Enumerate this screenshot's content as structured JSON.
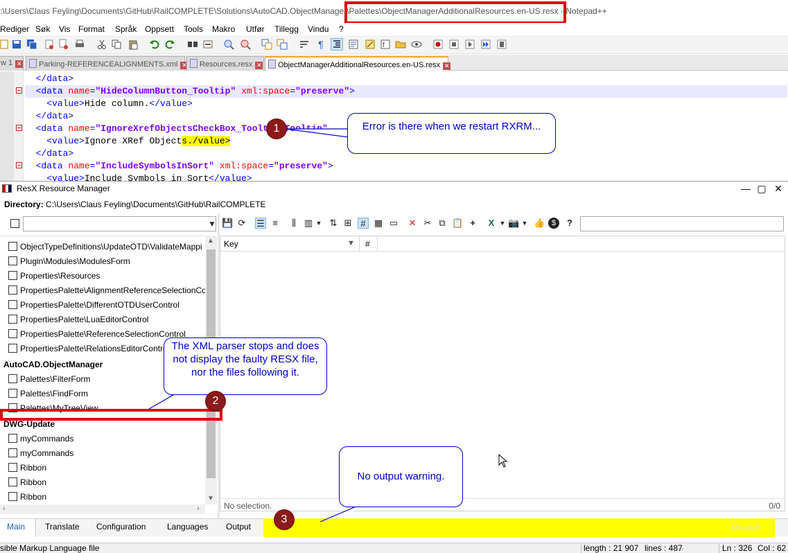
{
  "notepad": {
    "title_prefix": ":\\Users\\Claus Feyling\\Documents\\GitHub\\RailCOMPLETE\\Solutions\\AutoCAD.ObjectManager\\",
    "title_highlight": "Palettes\\ObjectManagerAdditionalResources.en-US.resx - ",
    "title_suffix": "Notepad++",
    "menu": [
      "Rediger",
      "Søk",
      "Vis",
      "Format",
      "Språk",
      "Oppsett",
      "Tools",
      "Makro",
      "Utfør",
      "Tillegg",
      "Vindu",
      "?"
    ],
    "tabs": [
      {
        "label": "w 1"
      },
      {
        "label": "Parking-REFERENCEALIGNMENTS.xml"
      },
      {
        "label": "Resources.resx"
      },
      {
        "label": "ObjectManagerAdditionalResources.en-US.resx"
      }
    ],
    "code": [
      {
        "indent": "  ",
        "close": "</data>"
      },
      {
        "indent": "  ",
        "open": "<data ",
        "attr1": "name",
        "eq1": "=",
        "val1": "\"HideColumnButton_Tooltip\"",
        "attr2": " xml:space",
        "eq2": "=",
        "val2": "\"preserve\"",
        "end": ">"
      },
      {
        "indent": "    ",
        "open": "<value>",
        "text": "Hide column.",
        "end": "</value>"
      },
      {
        "indent": "  ",
        "close": "</data>"
      },
      {
        "indent": "  ",
        "open": "<data ",
        "attr1": "name",
        "eq1": "=",
        "val1": "\"IgnoreXrefObjectsCheckBox_Tooltip_Tooltip\"",
        "end": ""
      },
      {
        "indent": "    ",
        "open": "<value>",
        "text": "Ignore XRef Object",
        "hl": "s./value>"
      },
      {
        "indent": "  ",
        "close": "</data>"
      },
      {
        "indent": "  ",
        "open": "<data ",
        "attr1": "name",
        "eq1": "=",
        "val1": "\"IncludeSymbolsInSort\"",
        "attr2": " xml:space",
        "eq2": "=",
        "val2": "\"preserve\"",
        "end": ">"
      },
      {
        "indent": "    ",
        "open": "<value>",
        "text": "Include Symbols in Sort",
        "end": "</value>"
      }
    ],
    "status": {
      "filetype": "sible Markup Language file",
      "length": "length : 21 907",
      "lines": "lines : 487",
      "ln": "Ln : 326",
      "col": "Col : 62"
    }
  },
  "resx": {
    "title": "ResX Resource Manager",
    "directory_label": "Directory:",
    "directory_value": "C:\\Users\\Claus Feyling\\Documents\\GitHub\\RailCOMPLETE",
    "list": [
      {
        "type": "item",
        "label": "ObjectTypeDefinitions\\UpdateOTD\\ValidateMappi"
      },
      {
        "type": "item",
        "label": "Plugin\\Modules\\ModulesForm"
      },
      {
        "type": "item",
        "label": "Properties\\Resources"
      },
      {
        "type": "item",
        "label": "PropertiesPalette\\AlignmentReferenceSelectionCo"
      },
      {
        "type": "item",
        "label": "PropertiesPalette\\DifferentOTDUserControl"
      },
      {
        "type": "item",
        "label": "PropertiesPalette\\LuaEditorControl"
      },
      {
        "type": "item",
        "label": "PropertiesPalette\\ReferenceSelectionControl"
      },
      {
        "type": "item",
        "label": "PropertiesPalette\\RelationsEditorControl"
      },
      {
        "type": "group",
        "label": "AutoCAD.ObjectManager"
      },
      {
        "type": "item",
        "label": "Palettes\\FilterForm"
      },
      {
        "type": "item",
        "label": "Palettes\\FindForm"
      },
      {
        "type": "item",
        "label": "Palettes\\MyTreeView"
      },
      {
        "type": "group",
        "label": "DWG-Update"
      },
      {
        "type": "item",
        "label": "myCommands"
      },
      {
        "type": "item",
        "label": "myCommands"
      },
      {
        "type": "item",
        "label": "Ribbon"
      },
      {
        "type": "item",
        "label": "Ribbon"
      },
      {
        "type": "item",
        "label": "Ribbon"
      }
    ],
    "grid": {
      "col_key": "Key",
      "col_hash": "#",
      "status_left": "No selection.",
      "status_right": "0/0"
    },
    "tabs": [
      "Main",
      "Translate",
      "Configuration",
      "Languages",
      "Output"
    ],
    "donate": "Donate"
  },
  "annotations": {
    "callout1": "Error is there when we restart RXRM...",
    "callout2": "The XML parser stops and does not display the faulty RESX file, nor the files following it.",
    "callout3": "No output warning.",
    "marker1": "1",
    "marker2": "2",
    "marker3": "3"
  },
  "colors": {
    "annotation_blue": "#0000cc",
    "marker_red": "#8b1a1a",
    "highlight_yellow": "#ffff00",
    "box_red": "#e00000"
  }
}
